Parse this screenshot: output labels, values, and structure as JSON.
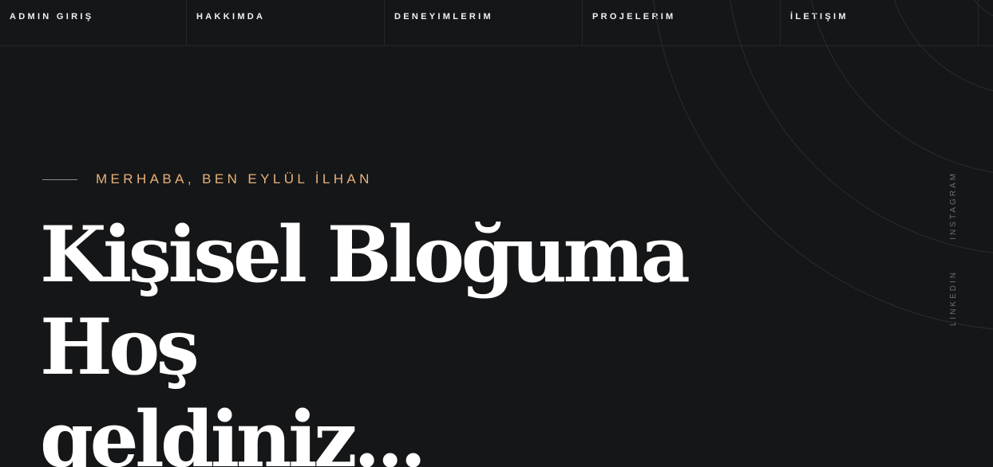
{
  "nav": {
    "items": [
      {
        "label": "ADMIN GIRIŞ"
      },
      {
        "label": "HAKKIMDA"
      },
      {
        "label": "DENEYIMLERIM"
      },
      {
        "label": "PROJELERIM"
      },
      {
        "label": "İLETIŞIM"
      }
    ]
  },
  "hero": {
    "intro": "MERHABA, BEN EYLÜL İLHAN",
    "headline_line1": "Kişisel Bloğuma Hoş",
    "headline_line2": "geldiniz..."
  },
  "social": {
    "instagram": "INSTAGRAM",
    "linkedin": "LINKEDIN"
  },
  "colors": {
    "background": "#151618",
    "accent": "#e7b27b",
    "text": "#ffffff",
    "muted": "#6d6e72"
  }
}
